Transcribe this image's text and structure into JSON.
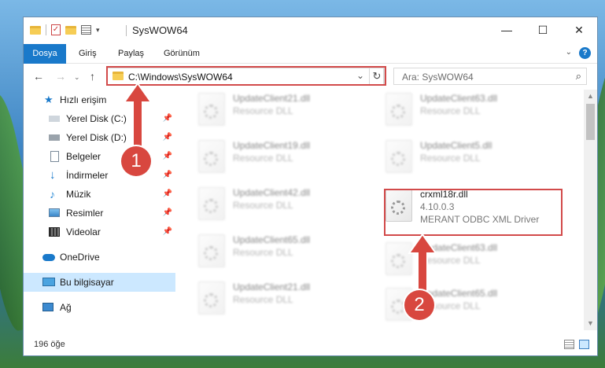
{
  "window": {
    "title": "SysWOW64",
    "caption": {
      "minimize": "—",
      "maximize": "☐",
      "close": "✕"
    }
  },
  "ribbon": {
    "tabs": [
      "Dosya",
      "Giriş",
      "Paylaş",
      "Görünüm"
    ],
    "help": "?"
  },
  "address": {
    "path": "C:\\Windows\\SysWOW64",
    "search_placeholder": "Ara: SysWOW64"
  },
  "sidebar": {
    "items": [
      {
        "label": "Hızlı erişim",
        "icon": "star-icon",
        "pinned": false
      },
      {
        "label": "Yerel Disk (C:)",
        "icon": "drive-icon",
        "pinned": true
      },
      {
        "label": "Yerel Disk (D:)",
        "icon": "drive-icon",
        "pinned": true
      },
      {
        "label": "Belgeler",
        "icon": "documents-icon",
        "pinned": true
      },
      {
        "label": "İndirmeler",
        "icon": "download-icon",
        "pinned": true
      },
      {
        "label": "Müzik",
        "icon": "music-icon",
        "pinned": true
      },
      {
        "label": "Resimler",
        "icon": "pictures-icon",
        "pinned": true
      },
      {
        "label": "Videolar",
        "icon": "videos-icon",
        "pinned": true
      },
      {
        "label": "OneDrive",
        "icon": "cloud-icon",
        "pinned": false
      },
      {
        "label": "Bu bilgisayar",
        "icon": "computer-icon",
        "pinned": false,
        "selected": true
      },
      {
        "label": "Ağ",
        "icon": "network-icon",
        "pinned": false
      }
    ]
  },
  "files": {
    "col1": [
      {
        "name": "UpdateClient21.dll",
        "type": "Resource DLL"
      },
      {
        "name": "UpdateClient19.dll",
        "type": "Resource DLL"
      },
      {
        "name": "UpdateClient42.dll",
        "type": "Resource DLL"
      },
      {
        "name": "UpdateClient65.dll",
        "type": "Resource DLL"
      },
      {
        "name": "UpdateClient21.dll",
        "type": "Resource DLL"
      }
    ],
    "col2_top": [
      {
        "name": "UpdateClient63.dll",
        "type": "Resource DLL"
      },
      {
        "name": "UpdateClient5.dll",
        "type": "Resource DLL"
      }
    ],
    "highlighted": {
      "name": "crxml18r.dll",
      "version": "4.10.0.3",
      "description": "MERANT ODBC XML Driver"
    },
    "col2_bottom": [
      {
        "name": "UpdateClient63.dll",
        "type": "Resource DLL"
      },
      {
        "name": "UpdateClient65.dll",
        "type": "Resource DLL"
      }
    ]
  },
  "status": {
    "count": "196 öğe"
  },
  "annotations": {
    "badge1": "1",
    "badge2": "2"
  },
  "colors": {
    "accent": "#1979ca",
    "highlight": "#d24a4a",
    "selected": "#cce8ff"
  }
}
